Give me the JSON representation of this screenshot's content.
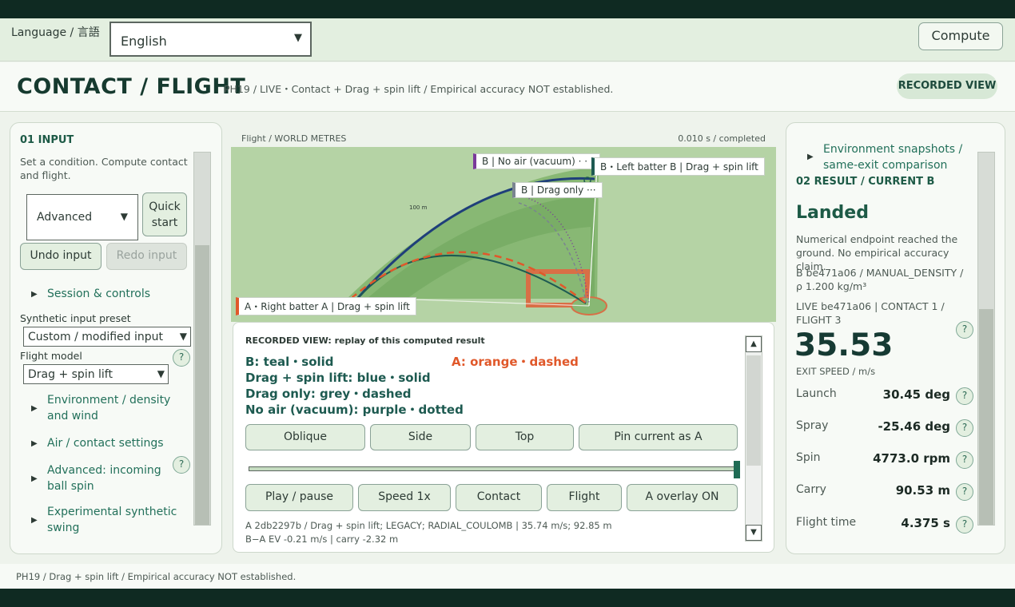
{
  "lang": {
    "label": "Language / 言語",
    "selected": "English"
  },
  "toolbar": {
    "compute_label": "Compute"
  },
  "header": {
    "title": "CONTACT / FLIGHT",
    "subtitle": "PH19 / LIVE・Contact + Drag + spin lift / Empirical accuracy NOT established.",
    "badge": "RECORDED VIEW"
  },
  "input_panel": {
    "heading": "01  INPUT",
    "description": "Set a condition. Compute contact and flight.",
    "mode_select": "Advanced",
    "quick_start": "Quick start",
    "undo": "Undo input",
    "redo": "Redo input",
    "session_link": "Session & controls",
    "preset_label": "Synthetic input preset",
    "preset_value": "Custom / modified input",
    "model_label": "Flight model",
    "model_value": "Drag + spin lift",
    "env_link": "Environment / density and wind",
    "air_link": "Air / contact settings",
    "spin_link": "Advanced: incoming ball spin",
    "swing_link": "Experimental synthetic swing"
  },
  "flight_panel": {
    "title": "Flight / WORLD METRES",
    "status": "0.010 s / completed",
    "tag_vacuum": "B | No air (vacuum) · · ·",
    "tag_b_main": "B・Left batter B | Drag + spin lift",
    "tag_drag_only": "B | Drag only ···",
    "tag_a": "A・Right batter A | Drag + spin lift",
    "distance_marker": "100 m"
  },
  "replay": {
    "heading": "RECORDED VIEW: replay of this computed result",
    "legend_b": "B: teal・solid",
    "legend_a": "A: orange・dashed",
    "legend_drag_spin": "Drag + spin lift: blue・solid",
    "legend_drag_only": "Drag only: grey・dashed",
    "legend_vacuum": "No air (vacuum): purple・dotted",
    "view_buttons": [
      "Oblique",
      "Side",
      "Top",
      "Pin current as A"
    ],
    "timeline_progress": 1.0,
    "play_buttons": [
      "Play / pause",
      "Speed 1x",
      "Contact",
      "Flight",
      "A overlay ON"
    ],
    "info_line1": "A 2db2297b / Drag + spin lift; LEGACY; RADIAL_COULOMB | 35.74 m/s; 92.85 m",
    "info_line2": "B−A EV -0.21 m/s | carry -2.32 m"
  },
  "result_panel": {
    "env_link": "Environment snapshots / same-exit comparison",
    "heading": "02  RESULT / CURRENT B",
    "status": "Landed",
    "status_desc": "Numerical endpoint reached the ground. No empirical accuracy claim.",
    "density": "B be471a06 / MANUAL_DENSITY / ρ 1.200 kg/m³",
    "live": "LIVE be471a06 | CONTACT 1 / FLIGHT 3",
    "exit_speed": "35.53",
    "exit_label": "EXIT SPEED / m/s",
    "rows": [
      {
        "label": "Launch",
        "value": "30.45 deg"
      },
      {
        "label": "Spray",
        "value": "-25.46 deg"
      },
      {
        "label": "Spin",
        "value": "4773.0 rpm"
      },
      {
        "label": "Carry",
        "value": "90.53 m"
      },
      {
        "label": "Flight time",
        "value": "4.375 s"
      }
    ]
  },
  "footer": {
    "text": "PH19 / Drag + spin lift / Empirical accuracy NOT established."
  },
  "colors": {
    "teal": "#1e5a52",
    "orange": "#e0582a",
    "blue": "#1f3f7a",
    "purple": "#7a3a9a",
    "field": "#7fb26a"
  },
  "icons": [
    "chevron-down-icon",
    "caret-right-icon",
    "help-icon",
    "scroll-up-icon",
    "scroll-down-icon"
  ]
}
